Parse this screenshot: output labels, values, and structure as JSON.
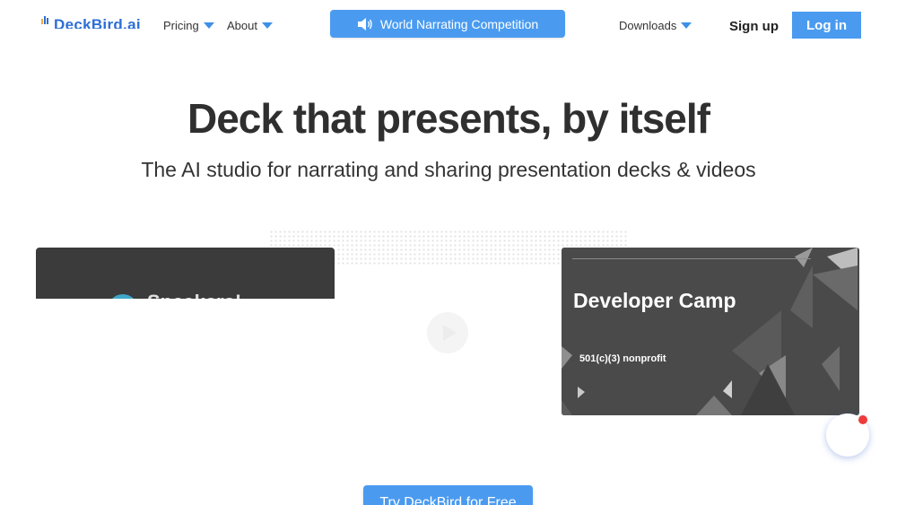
{
  "header": {
    "logo_text": "DeckBird.ai",
    "nav": {
      "pricing": "Pricing",
      "about": "About",
      "downloads": "Downloads"
    },
    "banner_label": "World Narrating Competition",
    "signup_label": "Sign up",
    "login_label": "Log in"
  },
  "hero": {
    "title": "Deck that presents, by itself",
    "subtitle": "The AI studio for narrating and sharing presentation decks & videos"
  },
  "cards": {
    "left_text": "Speakers!",
    "right_title": "Developer Camp",
    "right_subtitle": "501(c)(3) nonprofit"
  },
  "cta_label": "Try DeckBird for Free",
  "colors": {
    "accent": "#4a9bf0",
    "notification": "#ef3b3b"
  },
  "icons": [
    "speaker-icon",
    "chevron-down-icon",
    "play-icon",
    "chat-icon"
  ]
}
